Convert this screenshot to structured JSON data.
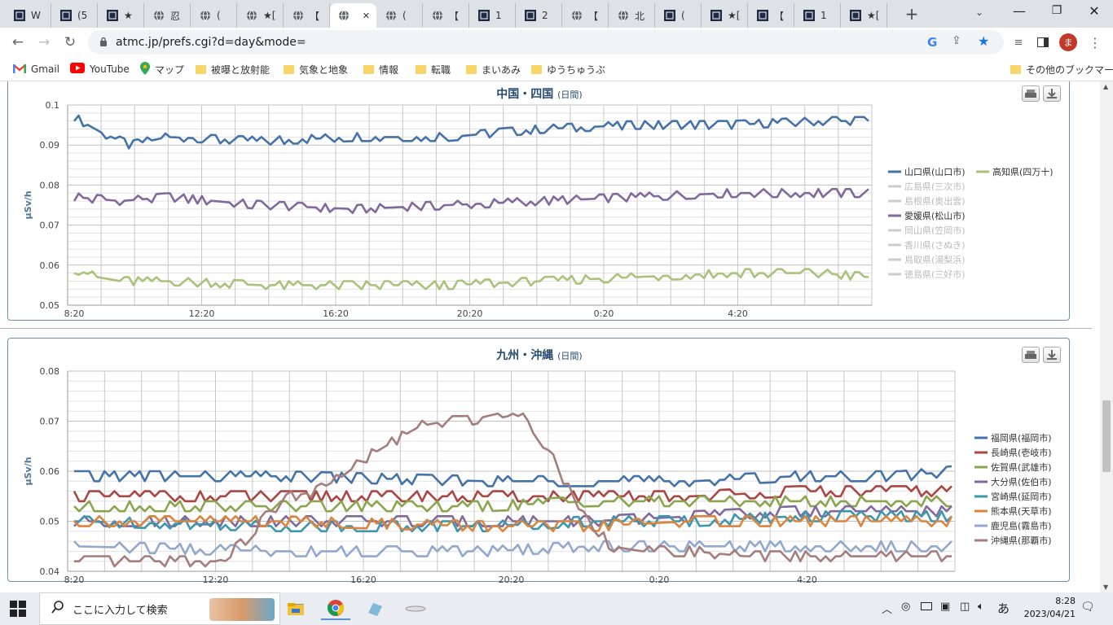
{
  "browser": {
    "tabs": [
      {
        "title": "W"
      },
      {
        "title": "(5"
      },
      {
        "title": "★"
      },
      {
        "title": "忍"
      },
      {
        "title": "("
      },
      {
        "title": "★["
      },
      {
        "title": "【"
      },
      {
        "title": "",
        "active": true
      },
      {
        "title": "("
      },
      {
        "title": "【"
      },
      {
        "title": "1"
      },
      {
        "title": "2"
      },
      {
        "title": "【"
      },
      {
        "title": "北"
      },
      {
        "title": "("
      },
      {
        "title": "★["
      },
      {
        "title": "【"
      },
      {
        "title": "1"
      },
      {
        "title": "★["
      }
    ],
    "url": "atmc.jp/prefs.cgi?d=day&mode=",
    "profile_initial": "ま",
    "bookmarks": [
      {
        "label": "Gmail",
        "icon": "gmail-icon"
      },
      {
        "label": "YouTube",
        "icon": "youtube-icon"
      },
      {
        "label": "マップ",
        "icon": "maps-icon"
      },
      {
        "label": "被曝と放射能",
        "icon": "folder-icon"
      },
      {
        "label": "気象と地象",
        "icon": "folder-icon"
      },
      {
        "label": "情報",
        "icon": "folder-icon"
      },
      {
        "label": "転職",
        "icon": "folder-icon"
      },
      {
        "label": "まいあみ",
        "icon": "folder-icon"
      },
      {
        "label": "ゆうちゅうぶ",
        "icon": "folder-icon"
      }
    ],
    "other_bookmarks": "その他のブックマーク"
  },
  "charts": {
    "chugoku": {
      "title": "中国・四国",
      "subtitle": "(日間)"
    },
    "kyushu": {
      "title": "九州・沖縄",
      "subtitle": "(日間)"
    }
  },
  "chart_data": [
    {
      "type": "line",
      "title": "中国・四国",
      "subtitle": "(日間)",
      "ylabel": "μSv/h",
      "ylim": [
        0.05,
        0.1
      ],
      "yticks": [
        "0.1",
        "0.09",
        "0.08",
        "0.07",
        "0.06",
        "0.05"
      ],
      "xticks": [
        "8:20",
        "12:20",
        "16:20",
        "20:20",
        "0:20",
        "4:20"
      ],
      "legend": [
        "山口県(山口市)",
        "高知県(四万十)",
        "広島県(三次市)",
        "島根県(奥出雲)",
        "愛媛県(松山市)",
        "岡山県(笠岡市)",
        "香川県(さぬき)",
        "鳥取県(湯梨浜)",
        "徳島県(三好市)"
      ],
      "hidden_series": [
        "広島県(三次市)",
        "島根県(奥出雲)",
        "岡山県(笠岡市)",
        "香川県(さぬき)",
        "鳥取県(湯梨浜)",
        "徳島県(三好市)"
      ],
      "series": [
        {
          "name": "山口県(山口市)",
          "color": "#4572a7",
          "anchors": [
            [
              0,
              0.097
            ],
            [
              6,
              0.093
            ],
            [
              12,
              0.09
            ],
            [
              20,
              0.092
            ],
            [
              40,
              0.091
            ],
            [
              60,
              0.092
            ],
            [
              80,
              0.092
            ],
            [
              100,
              0.094
            ],
            [
              120,
              0.095
            ],
            [
              140,
              0.095
            ],
            [
              160,
              0.096
            ],
            [
              170,
              0.096
            ]
          ]
        },
        {
          "name": "愛媛県(松山市)",
          "color": "#80699b",
          "anchors": [
            [
              0,
              0.077
            ],
            [
              10,
              0.076
            ],
            [
              20,
              0.077
            ],
            [
              40,
              0.075
            ],
            [
              60,
              0.074
            ],
            [
              80,
              0.075
            ],
            [
              100,
              0.076
            ],
            [
              120,
              0.077
            ],
            [
              140,
              0.078
            ],
            [
              160,
              0.078
            ],
            [
              170,
              0.078
            ]
          ]
        },
        {
          "name": "高知県(四万十)",
          "color": "#aac27b",
          "anchors": [
            [
              0,
              0.059
            ],
            [
              5,
              0.057
            ],
            [
              10,
              0.056
            ],
            [
              20,
              0.056
            ],
            [
              40,
              0.055
            ],
            [
              60,
              0.055
            ],
            [
              80,
              0.055
            ],
            [
              100,
              0.056
            ],
            [
              120,
              0.057
            ],
            [
              140,
              0.058
            ],
            [
              160,
              0.058
            ],
            [
              170,
              0.057
            ]
          ]
        }
      ]
    },
    {
      "type": "line",
      "title": "九州・沖縄",
      "subtitle": "(日間)",
      "ylabel": "μSv/h",
      "ylim": [
        0.04,
        0.08
      ],
      "yticks": [
        "0.08",
        "0.07",
        "0.06",
        "0.05",
        "0.04"
      ],
      "xticks": [
        "8:20",
        "12:20",
        "16:20",
        "20:20",
        "0:20",
        "4:20"
      ],
      "legend": [
        "福岡県(福岡市)",
        "長崎県(壱岐市)",
        "佐賀県(武雄市)",
        "大分県(佐伯市)",
        "宮崎県(延岡市)",
        "熊本県(天草市)",
        "鹿児島(霧島市)",
        "沖縄県(那覇市)"
      ],
      "series": [
        {
          "name": "福岡県(福岡市)",
          "color": "#4572a7",
          "anchors": [
            [
              0,
              0.059
            ],
            [
              40,
              0.059
            ],
            [
              80,
              0.058
            ],
            [
              120,
              0.058
            ],
            [
              140,
              0.059
            ],
            [
              160,
              0.059
            ],
            [
              170,
              0.06
            ]
          ]
        },
        {
          "name": "長崎県(壱岐市)",
          "color": "#aa4643",
          "anchors": [
            [
              0,
              0.055
            ],
            [
              30,
              0.055
            ],
            [
              60,
              0.055
            ],
            [
              80,
              0.055
            ],
            [
              100,
              0.055
            ],
            [
              120,
              0.055
            ],
            [
              140,
              0.056
            ],
            [
              170,
              0.056
            ]
          ]
        },
        {
          "name": "佐賀県(武雄市)",
          "color": "#89a54e",
          "anchors": [
            [
              0,
              0.053
            ],
            [
              40,
              0.053
            ],
            [
              80,
              0.053
            ],
            [
              100,
              0.054
            ],
            [
              120,
              0.054
            ],
            [
              140,
              0.054
            ],
            [
              170,
              0.054
            ]
          ]
        },
        {
          "name": "大分県(佐伯市)",
          "color": "#80699b",
          "anchors": [
            [
              0,
              0.05
            ],
            [
              40,
              0.05
            ],
            [
              80,
              0.05
            ],
            [
              100,
              0.05
            ],
            [
              120,
              0.051
            ],
            [
              140,
              0.052
            ],
            [
              170,
              0.052
            ]
          ]
        },
        {
          "name": "宮崎県(延岡市)",
          "color": "#3d96ae",
          "anchors": [
            [
              0,
              0.05
            ],
            [
              40,
              0.049
            ],
            [
              80,
              0.049
            ],
            [
              100,
              0.05
            ],
            [
              120,
              0.05
            ],
            [
              140,
              0.051
            ],
            [
              170,
              0.051
            ]
          ]
        },
        {
          "name": "熊本県(天草市)",
          "color": "#db843d",
          "anchors": [
            [
              0,
              0.05
            ],
            [
              40,
              0.05
            ],
            [
              80,
              0.049
            ],
            [
              100,
              0.049
            ],
            [
              120,
              0.05
            ],
            [
              140,
              0.05
            ],
            [
              170,
              0.05
            ]
          ]
        },
        {
          "name": "鹿児島(霧島市)",
          "color": "#92a8cd",
          "anchors": [
            [
              0,
              0.045
            ],
            [
              40,
              0.044
            ],
            [
              80,
              0.044
            ],
            [
              100,
              0.045
            ],
            [
              120,
              0.045
            ],
            [
              140,
              0.045
            ],
            [
              170,
              0.045
            ]
          ]
        },
        {
          "name": "沖縄県(那覇市)",
          "color": "#a47d7c",
          "anchors": [
            [
              0,
              0.042
            ],
            [
              20,
              0.042
            ],
            [
              28,
              0.042
            ],
            [
              33,
              0.046
            ],
            [
              38,
              0.052
            ],
            [
              42,
              0.055
            ],
            [
              47,
              0.056
            ],
            [
              52,
              0.059
            ],
            [
              57,
              0.063
            ],
            [
              62,
              0.066
            ],
            [
              67,
              0.069
            ],
            [
              72,
              0.07
            ],
            [
              76,
              0.07
            ],
            [
              80,
              0.071
            ],
            [
              84,
              0.072
            ],
            [
              88,
              0.07
            ],
            [
              92,
              0.064
            ],
            [
              96,
              0.056
            ],
            [
              100,
              0.05
            ],
            [
              104,
              0.045
            ],
            [
              110,
              0.044
            ],
            [
              120,
              0.044
            ],
            [
              130,
              0.043
            ],
            [
              140,
              0.043
            ],
            [
              150,
              0.043
            ],
            [
              160,
              0.043
            ],
            [
              170,
              0.043
            ]
          ]
        }
      ]
    }
  ],
  "taskbar": {
    "search_placeholder": "ここに入力して検索",
    "time": "8:28",
    "date": "2023/04/21",
    "ime": "あ"
  }
}
